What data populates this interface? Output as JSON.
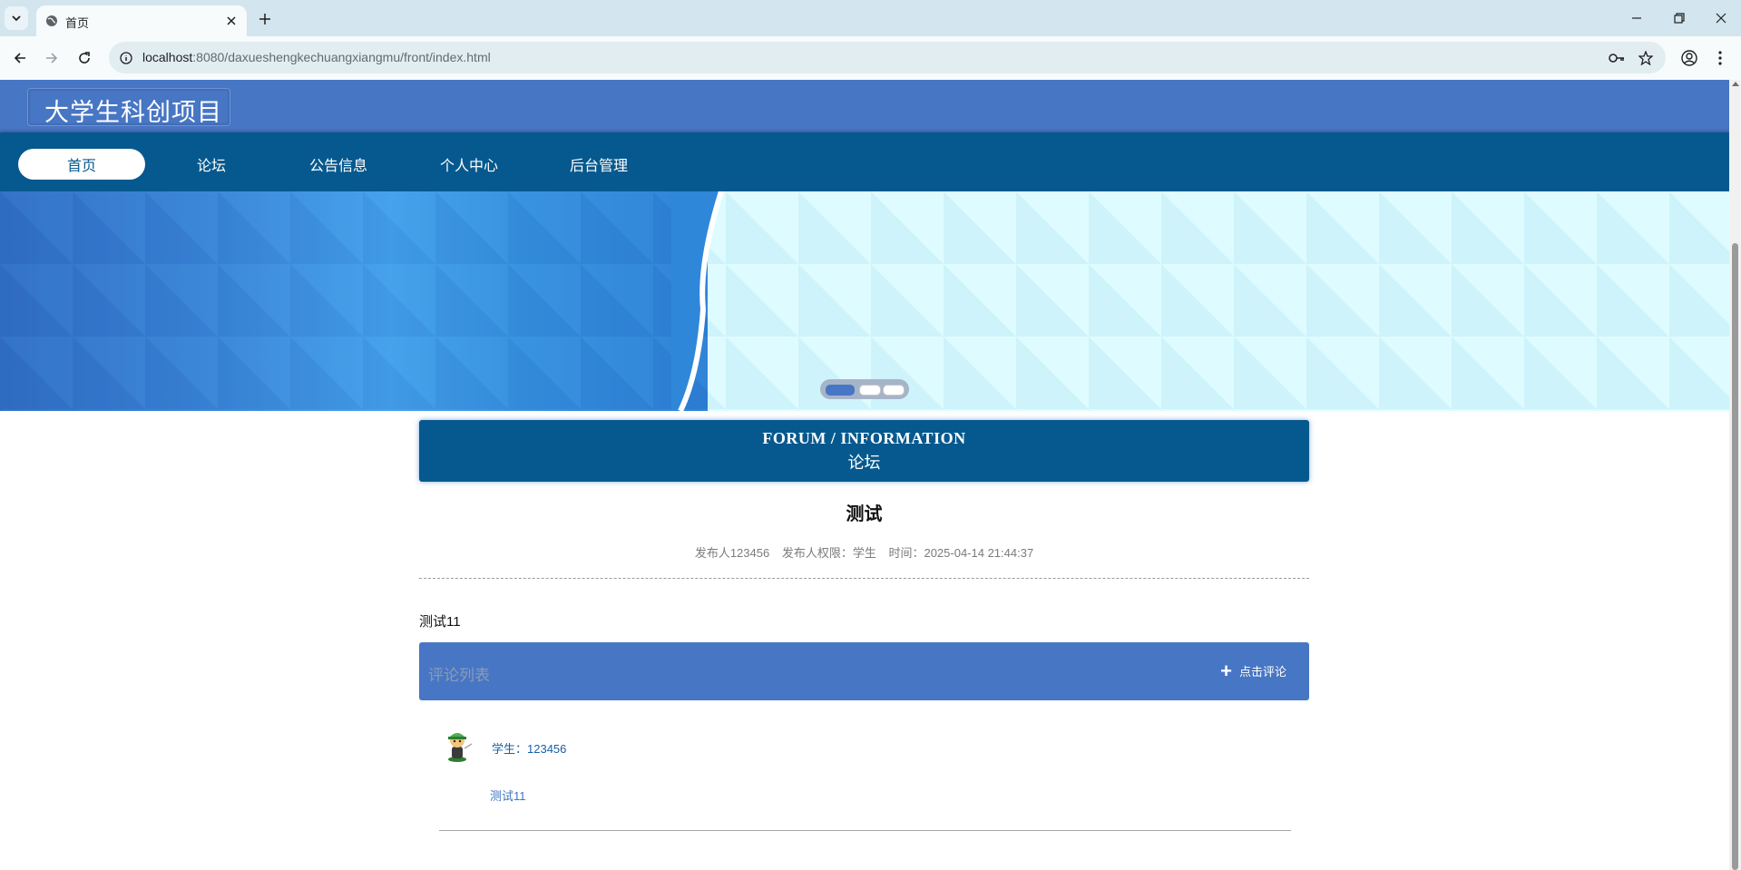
{
  "browser": {
    "tab_title": "首页",
    "url_host": "localhost",
    "url_path": ":8080/daxueshengkechuangxiangmu/front/index.html"
  },
  "site": {
    "logo_text": "大学生科创项目",
    "nav": [
      {
        "label": "首页",
        "active": true
      },
      {
        "label": "论坛",
        "active": false
      },
      {
        "label": "公告信息",
        "active": false
      },
      {
        "label": "个人中心",
        "active": false
      },
      {
        "label": "后台管理",
        "active": false
      }
    ]
  },
  "section": {
    "title_en": "FORUM / INFORMATION",
    "title_cn": "论坛"
  },
  "post": {
    "title": "测试",
    "author": "发布人123456",
    "role": "发布人权限：学生",
    "time": "时间：2025-04-14 21:44:37",
    "content": "测试11"
  },
  "comments": {
    "header": "评论列表",
    "add_label": "点击评论",
    "items": [
      {
        "user": "学生：123456",
        "text": "测试11"
      }
    ]
  },
  "colors": {
    "header_blue": "#4776c4",
    "nav_blue": "#06598e"
  }
}
